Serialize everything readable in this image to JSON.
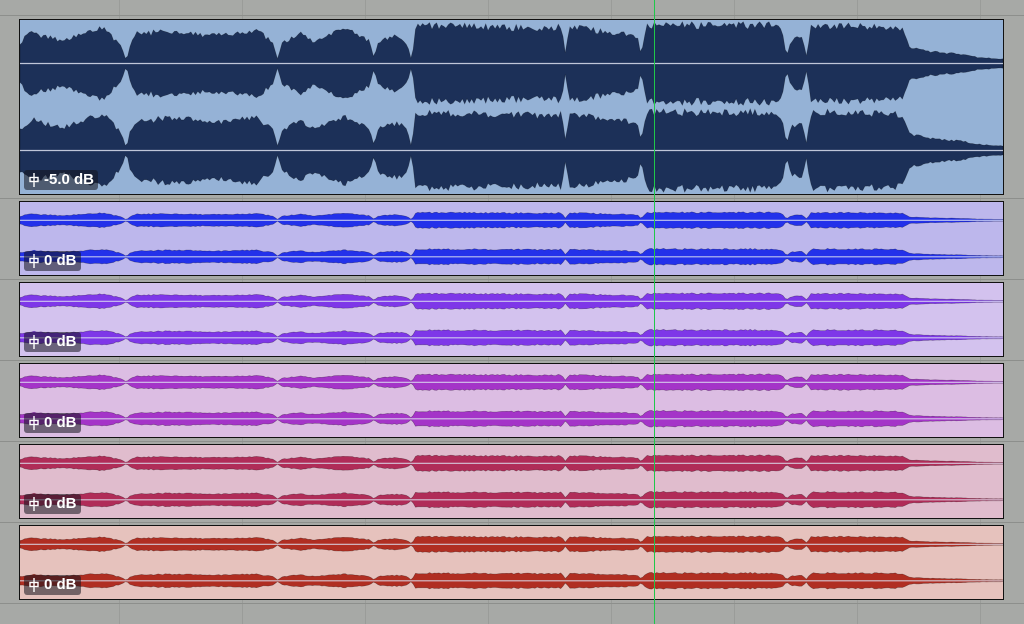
{
  "tracks": [
    {
      "volume_label": "-5.0 dB",
      "wave_color": "#1c3058",
      "bg_color": "#95b2d6",
      "amplitude": 0.96
    },
    {
      "volume_label": "0 dB",
      "wave_color": "#2331ea",
      "bg_color": "#bdb7ec",
      "amplitude": 0.46
    },
    {
      "volume_label": "0 dB",
      "wave_color": "#7e37e8",
      "bg_color": "#d3c2ee",
      "amplitude": 0.46
    },
    {
      "volume_label": "0 dB",
      "wave_color": "#a434c8",
      "bg_color": "#dcbde3",
      "amplitude": 0.46
    },
    {
      "volume_label": "0 dB",
      "wave_color": "#b02c58",
      "bg_color": "#e0bccd",
      "amplitude": 0.46
    },
    {
      "volume_label": "0 dB",
      "wave_color": "#b02e22",
      "bg_color": "#e6c2bd",
      "amplitude": 0.46
    }
  ],
  "icons": {
    "volume": "fader-icon"
  }
}
